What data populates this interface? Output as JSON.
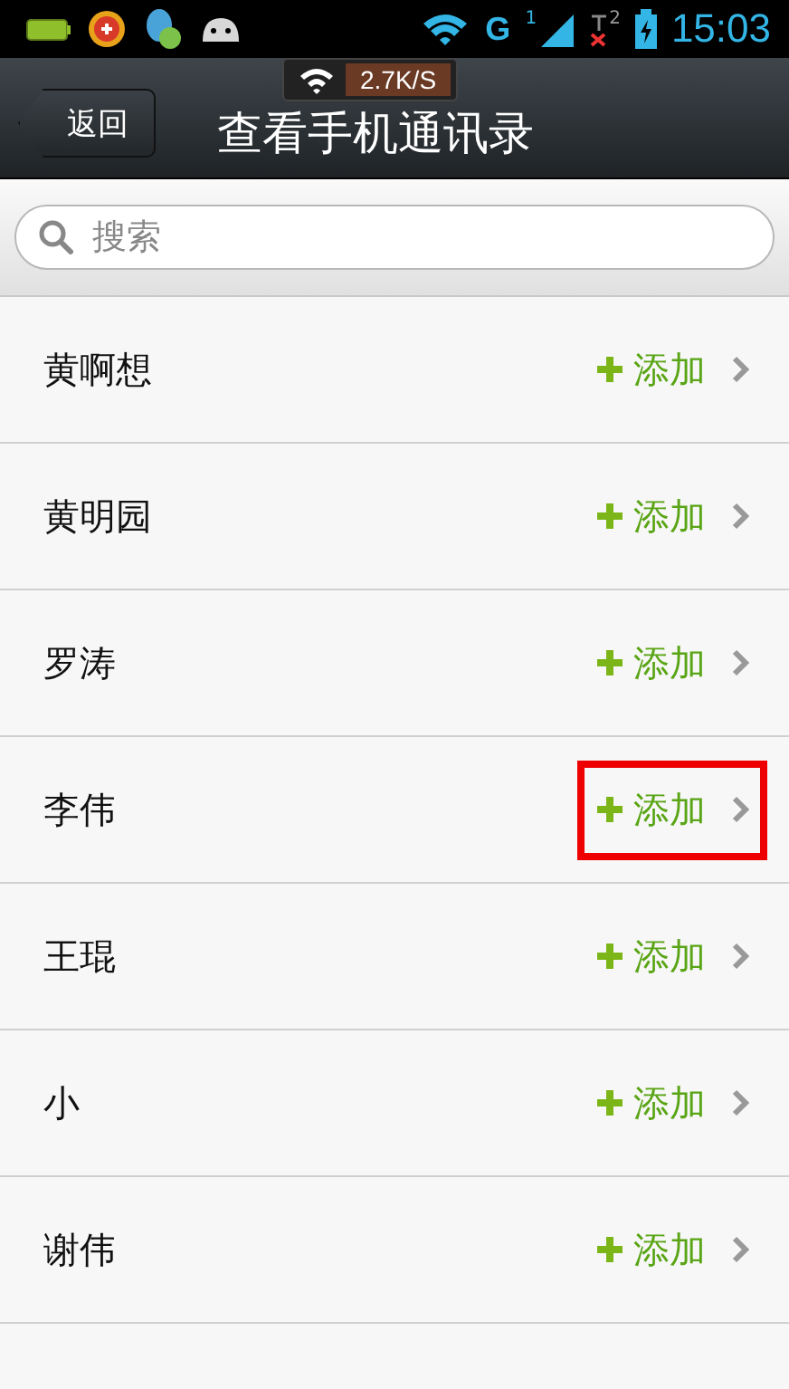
{
  "status_bar": {
    "network": "G",
    "sim_1": "1",
    "sim_2": "2",
    "time": "15:03"
  },
  "speed_overlay": {
    "speed": "2.7K/S"
  },
  "header": {
    "back": "返回",
    "title": "查看手机通讯录"
  },
  "search": {
    "placeholder": "搜索"
  },
  "contacts": [
    {
      "name": "黄啊想",
      "action": "添加",
      "highlighted": false
    },
    {
      "name": "黄明园",
      "action": "添加",
      "highlighted": false
    },
    {
      "name": "罗涛",
      "action": "添加",
      "highlighted": false
    },
    {
      "name": "李伟",
      "action": "添加",
      "highlighted": true
    },
    {
      "name": "王琨",
      "action": "添加",
      "highlighted": false
    },
    {
      "name": "小",
      "action": "添加",
      "highlighted": false
    },
    {
      "name": "谢伟",
      "action": "添加",
      "highlighted": false
    }
  ]
}
